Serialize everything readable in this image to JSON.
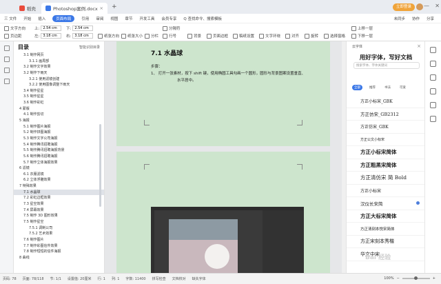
{
  "titlebar": {
    "tabs": [
      {
        "label": "稻壳",
        "color": "#e94b3c"
      },
      {
        "label": "Photoshop案例.docx",
        "color": "#3b78e7",
        "close": "×"
      }
    ],
    "add": "+",
    "login": "立即登录",
    "window_controls": [
      "—",
      "❐",
      "✕"
    ]
  },
  "menubar": {
    "items": [
      "三 文件",
      "开始",
      "插入",
      "页面布局",
      "引用",
      "审阅",
      "视图",
      "章节",
      "开发工具",
      "会员专享",
      "Q 查找命令、搜索模板"
    ],
    "active_index": 3,
    "right_items": [
      "未同步",
      "协作",
      "分享"
    ]
  },
  "ribbon": {
    "row1": [
      {
        "label": "文字方向",
        "icon": "text-direction-icon"
      },
      {
        "label": "页边距",
        "icon": "margins-icon"
      },
      {
        "label": "上: 2.54 cm"
      },
      {
        "label": "左: 3.18 cm"
      },
      {
        "label": "纸张方向",
        "icon": "orientation-icon"
      },
      {
        "label": "纸张大小",
        "icon": "paper-size-icon"
      },
      {
        "label": "分栏",
        "icon": "columns-icon"
      },
      {
        "label": "分隔符",
        "icon": "separator-icon"
      },
      {
        "label": "行号",
        "icon": "line-number-icon"
      },
      {
        "label": "背景",
        "icon": "background-icon"
      },
      {
        "label": "页面边框",
        "icon": "page-border-icon"
      },
      {
        "label": "稿纸设置",
        "icon": "manuscript-icon"
      },
      {
        "label": "文字环绕",
        "icon": "wrap-icon"
      },
      {
        "label": "对齐",
        "icon": "align-icon"
      },
      {
        "label": "旋转",
        "icon": "rotate-icon"
      },
      {
        "label": "选择窗格",
        "icon": "selection-pane-icon"
      },
      {
        "label": "上移一层",
        "icon": "bring-forward-icon"
      },
      {
        "label": "下移一层",
        "icon": "send-backward-icon"
      }
    ],
    "top_value": "2.54 cm",
    "bottom_value": "2.54 cm",
    "left_value": "3.18 cm",
    "right_value": "3.18 cm",
    "top_label": "上:",
    "bottom_label": "下:",
    "left_label": "左:",
    "right_label": "右:"
  },
  "toc": {
    "title": "目录",
    "smart": "智能识别目录",
    "items": [
      "3.1 制作网页",
      "3.1.1 画局部",
      "3.2 制作文字效果",
      "3.2 制作下雨天",
      "3.2.1 使用滤镜创建",
      "3.2.2 使用图像调整下雨天",
      "3.4 制作星星",
      "3.5 制作星星",
      "3.6 制作彩虹",
      "4 蒙版",
      "4.1 制作剪切",
      "5 海报",
      "5.1 制作图片海报",
      "5.2 制作拼图海报",
      "5.3 制作文字公司海报",
      "5.4 制作腾讯招聘海报",
      "5.5 制作腾讯招聘海报背景",
      "5.6 制作腾讯招聘海报",
      "5.7 制作立体海报效果",
      "6 滤镜",
      "6.1 衣服滤镜",
      "6.2 立体浮雕效果",
      "7 特殊效果",
      "7.1 水晶球",
      "7.2 彩虹边框效果",
      "7.3 星空效果",
      "7.4 屏幕效果",
      "7.5 制作 3D 图形效果",
      "7.5 制作星空",
      "7.5.1 调制公司",
      "7.5.2 艺术效果",
      "7.6 制作图片",
      "7.7 制作彩图信件效果",
      "7.8 制作短短的信件海报",
      "8 曲线"
    ],
    "selected_index": 23
  },
  "document": {
    "heading": "7.1 水晶球",
    "steps_label": "步骤：",
    "step1": "1、  打开一张素材，按下 shift 键，使用椭圆工具勾画一个圆形，圆形与背景图案设置垂直、",
    "step1b": "水平居中。"
  },
  "right_panel": {
    "label": "云字体",
    "close": "×",
    "title": "用好字体，写好文档",
    "search_placeholder": "搜索字体、字体关键词",
    "tabs": [
      "全部",
      "推荐",
      "书法",
      "可爱"
    ],
    "active_tab": 0,
    "fonts": [
      {
        "name": "方正小标宋_GBK",
        "size": 6
      },
      {
        "name": "方正仿宋_GB2312",
        "size": 6.5
      },
      {
        "name": "方正仿宋_GBK",
        "size": 6
      },
      {
        "name": "方正公文小标宋",
        "size": 5
      },
      {
        "name": "方正小标宋简体",
        "size": 7.5,
        "bold": true
      },
      {
        "name": "方正粗黑宋简体",
        "size": 7.5,
        "bold": true
      },
      {
        "name": "方正清仿宋 简 Bold",
        "size": 7.5
      },
      {
        "name": "方正小标宋",
        "size": 6
      },
      {
        "name": "汉仪长宋简",
        "size": 6.5,
        "flag": true
      },
      {
        "name": "方正大标宋简体",
        "size": 7.5,
        "bold": true
      },
      {
        "name": "方正清刻本悦宋简体",
        "size": 5.5
      },
      {
        "name": "方正宋刻本秀楷",
        "size": 7
      },
      {
        "name": "华文中宋",
        "size": 7
      }
    ]
  },
  "statusbar": {
    "items": [
      "页码: 78",
      "页面: 78/118",
      "节: 1/1",
      "设置值: 20厘米",
      "行: 1",
      "列: 1",
      "字数: 11400",
      "拼写检查",
      "文档校对",
      "缺失字体"
    ],
    "zoom": "100%",
    "zoom_minus": "−",
    "zoom_plus": "+"
  },
  "watermark": "Bai 经验",
  "colors": {
    "accent": "#3b78e7",
    "page_green": "#cde5cd",
    "login": "#f0a43a"
  }
}
